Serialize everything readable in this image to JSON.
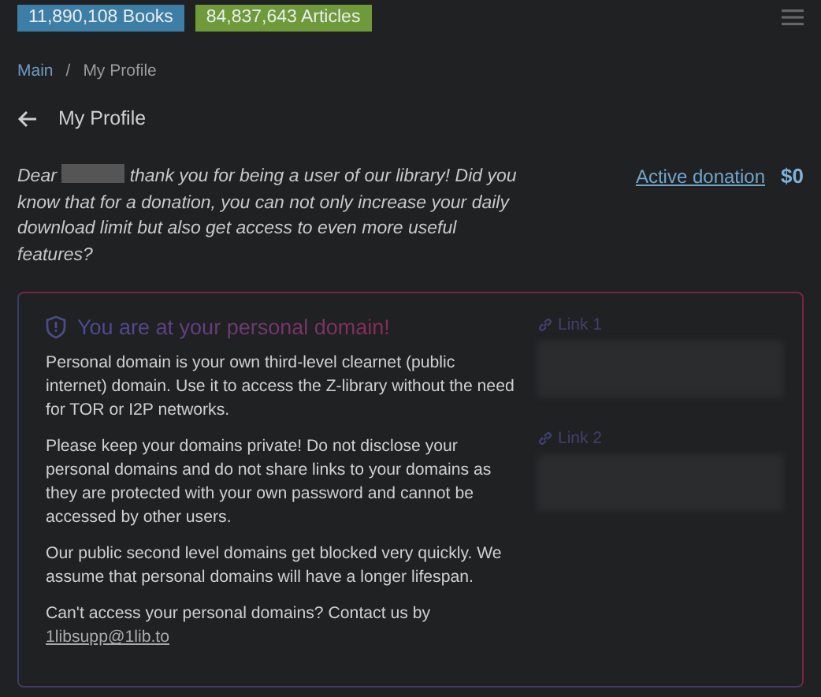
{
  "stats": [
    {
      "label": "11,890,108 Books",
      "color": "#3d7ea6"
    },
    {
      "label": "84,837,643 Articles",
      "color": "#6f9a3a"
    }
  ],
  "breadcrumb": [
    {
      "label": "Main",
      "link": true
    },
    {
      "label": "My Profile",
      "link": false
    }
  ],
  "breadcrumb_separator": "/",
  "page_title": "My Profile",
  "greeting": {
    "before": "Dear",
    "after": "thank you for being a user of our library! Did you know that for a donation, you can not only increase your daily download limit but also get access to even more useful features?"
  },
  "donation": {
    "label": "Active donation",
    "amount": "$0"
  },
  "domain_card": {
    "title": "You are at your personal domain!",
    "paragraphs": [
      "Personal domain is your own third-level clearnet (public internet) domain. Use it to access the Z-library without the need for TOR or I2P networks.",
      "Please keep your domains private! Do not disclose your personal domains and do not share links to your domains as they are protected with your own password and cannot be accessed by other users.",
      "Our public second level domains get blocked very quickly. We assume that personal domains will have a longer lifespan."
    ],
    "contact": {
      "text": "Can't access your personal domains? Contact us by",
      "email": "1libsupp@1lib.to"
    },
    "links": [
      {
        "label": "Link 1"
      },
      {
        "label": "Link 2"
      }
    ]
  }
}
